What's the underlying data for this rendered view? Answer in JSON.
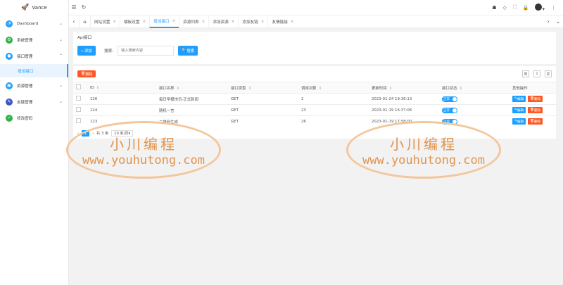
{
  "brand": {
    "name": "Vance"
  },
  "sidebar": {
    "items": [
      {
        "label": "Dashboard",
        "color": "#1e9fff",
        "icon": "dashboard-icon"
      },
      {
        "label": "系统管理",
        "color": "#2fb344",
        "icon": "settings-icon"
      },
      {
        "label": "接口管理",
        "color": "#1e9fff",
        "icon": "api-icon",
        "expanded": true
      },
      {
        "label": "资源管理",
        "color": "#1e9fff",
        "icon": "resource-icon"
      },
      {
        "label": "友链管理",
        "color": "#3a55c9",
        "icon": "link-icon"
      },
      {
        "label": "修改密码",
        "color": "#2fb344",
        "icon": "password-icon"
      }
    ],
    "sub_active": "增加接口"
  },
  "tabs": [
    {
      "label": "网站设置"
    },
    {
      "label": "模板设置"
    },
    {
      "label": "增加接口",
      "active": true
    },
    {
      "label": "资源列表"
    },
    {
      "label": "添加资源"
    },
    {
      "label": "添加友链"
    },
    {
      "label": "友情链接"
    }
  ],
  "card": {
    "title": "Api接口",
    "add_label": "+ 添加",
    "search_label": "搜索:",
    "search_placeholder": "输入搜索内容",
    "search_button": "搜索"
  },
  "table": {
    "delete_label": "删除",
    "columns": [
      "ID",
      "接口名称",
      "接口类型",
      "调用次数",
      "更新时间",
      "接口状态",
      "其他操作"
    ],
    "rows": [
      {
        "id": "126",
        "name": "每日早报快讯-正式新闻",
        "type": "GET",
        "calls": "2",
        "time": "2023-01-24 19:36:13",
        "status": "正常"
      },
      {
        "id": "124",
        "name": "随机一言",
        "type": "GET",
        "calls": "23",
        "time": "2023-01-19 16:37:06",
        "status": "正常"
      },
      {
        "id": "123",
        "name": "二维码生成",
        "type": "GET",
        "calls": "26",
        "time": "2023-01-19 17:58:00",
        "status": "正常"
      }
    ],
    "edit_label": "编辑",
    "remove_label": "删除"
  },
  "pager": {
    "current": "1",
    "total_text": "共 3 条",
    "size_text": "10 条/页"
  },
  "watermark": {
    "line1": "小川编程",
    "line2": "www.youhutong.com"
  }
}
